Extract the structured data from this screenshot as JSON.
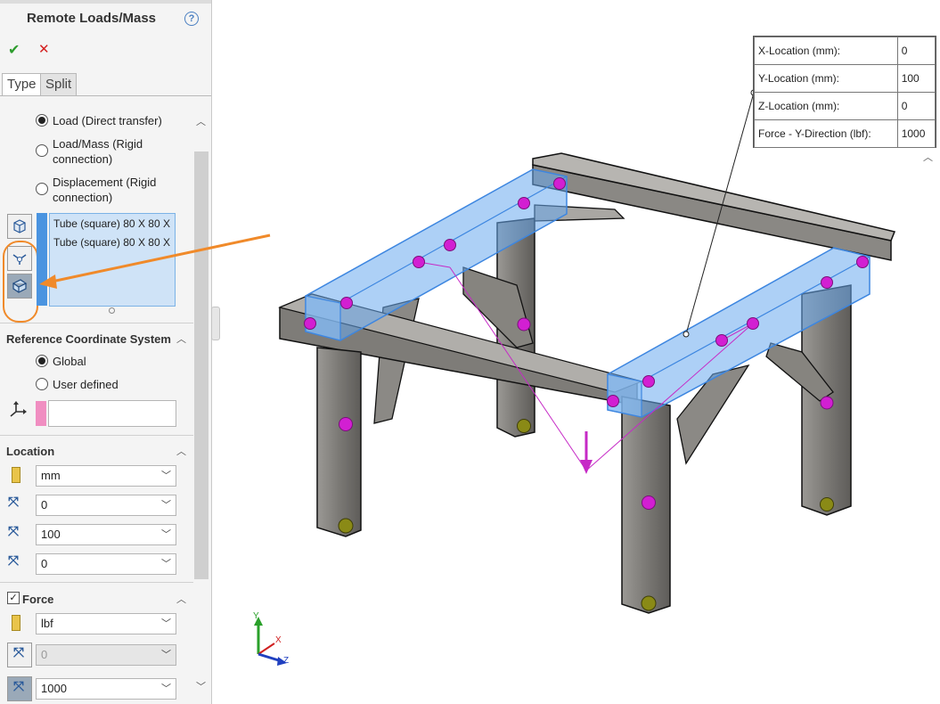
{
  "panel": {
    "title": "Remote Loads/Mass",
    "help_icon": "?",
    "ok_icon": "✔",
    "cancel_icon": "✕",
    "tabs": [
      {
        "label": "Type"
      },
      {
        "label": "Split"
      }
    ],
    "type_options": [
      {
        "label": "Load (Direct transfer)",
        "selected": true
      },
      {
        "label": "Load/Mass (Rigid\nconnection)",
        "selected": false
      },
      {
        "label": "Displacement (Rigid\nconnection)",
        "selected": false
      }
    ],
    "selections": [
      "Tube (square) 80 X 80 X",
      "Tube (square) 80 X 80 X"
    ],
    "reference": {
      "header": "Reference Coordinate System",
      "options": [
        {
          "label": "Global",
          "selected": true
        },
        {
          "label": "User defined",
          "selected": false
        }
      ]
    },
    "location": {
      "header": "Location",
      "unit": "mm",
      "x": "0",
      "y": "100",
      "z": "0"
    },
    "force": {
      "header": "Force",
      "checked": true,
      "unit": "lbf",
      "x_value": "0",
      "y_value": "1000"
    }
  },
  "annotation": {
    "rows": [
      {
        "label": "X-Location (mm):",
        "value": "0"
      },
      {
        "label": "Y-Location (mm):",
        "value": "100"
      },
      {
        "label": "Z-Location (mm):",
        "value": "0"
      },
      {
        "label": "Force -  Y-Direction (lbf):",
        "value": "1000"
      }
    ]
  },
  "triad": {
    "x": "X",
    "y": "Y",
    "z": "Z"
  },
  "colors": {
    "selection_blue": "#4a94e0",
    "connector_magenta": "#c62ac6",
    "callout_orange": "#f08a2a",
    "frame_gray": "#7a7874"
  }
}
